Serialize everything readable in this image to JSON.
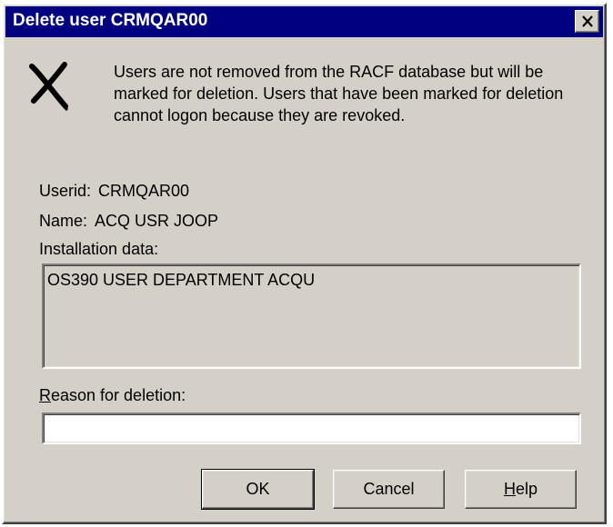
{
  "window": {
    "title": "Delete user CRMQAR00",
    "close_glyph": "close-icon"
  },
  "message": {
    "icon": "delete-x-icon",
    "text": "Users are not removed from the RACF database but will be marked for deletion. Users that have been marked for deletion cannot logon because they are revoked."
  },
  "userid": {
    "label": "Userid:",
    "value": "CRMQAR00"
  },
  "name": {
    "label": "Name:",
    "value": "ACQ USR JOOP"
  },
  "installation": {
    "label": "Installation data:",
    "value": "OS390 USER DEPARTMENT ACQU"
  },
  "reason": {
    "label_mnemonic": "R",
    "label_rest": "eason for deletion:",
    "value": ""
  },
  "buttons": {
    "ok": "OK",
    "cancel": "Cancel",
    "help_mnemonic": "H",
    "help_rest": "elp"
  },
  "colors": {
    "titlebar": "#000080",
    "face": "#d4d0c8"
  }
}
